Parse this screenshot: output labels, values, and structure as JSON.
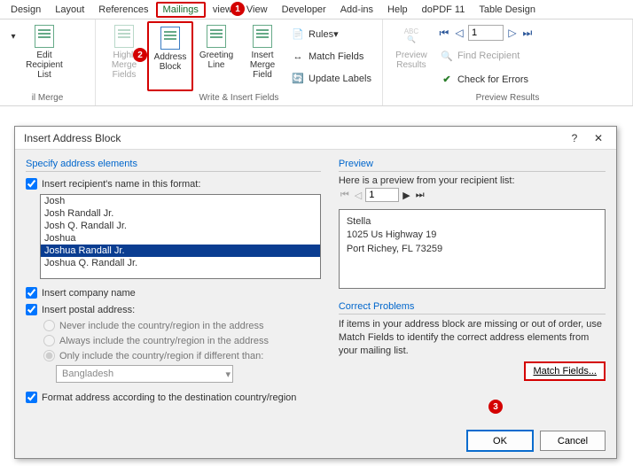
{
  "tabs": {
    "design": "Design",
    "layout": "Layout",
    "references": "References",
    "mailings": "Mailings",
    "review": "view",
    "view": "View",
    "developer": "Developer",
    "addins": "Add-ins",
    "help": "Help",
    "dopdf": "doPDF 11",
    "tabledesign": "Table Design"
  },
  "ribbon": {
    "start": {
      "edit": "Edit\nRecipient List",
      "group": "il Merge"
    },
    "write": {
      "highlight": "Highli\nMerge Fields",
      "address": "Address\nBlock",
      "greeting": "Greeting\nLine",
      "insertmerge": "Insert Merge\nField",
      "rules": "Rules",
      "match": "Match Fields",
      "update": "Update Labels",
      "group": "Write & Insert Fields"
    },
    "preview": {
      "abc": "ABC",
      "preview": "Preview\nResults",
      "find": "Find Recipient",
      "check": "Check for Errors",
      "group": "Preview Results",
      "navval": "1"
    }
  },
  "dialog": {
    "title": "Insert Address Block",
    "specify": "Specify address elements",
    "ck_name": "Insert recipient's name in this format:",
    "names": [
      "Josh",
      "Josh Randall Jr.",
      "Josh Q. Randall Jr.",
      "Joshua",
      "Joshua Randall Jr.",
      "Joshua Q. Randall Jr."
    ],
    "ck_company": "Insert company name",
    "ck_postal": "Insert postal address:",
    "r_never": "Never include the country/region in the address",
    "r_always": "Always include the country/region in the address",
    "r_only": "Only include the country/region if different than:",
    "combo": "Bangladesh",
    "ck_format": "Format address according to the destination country/region",
    "preview": "Preview",
    "preview_sub": "Here is a preview from your recipient list:",
    "preview_nav": "1",
    "p1": "Stella",
    "p2": "1025 Us Highway 19",
    "p3": "Port Richey, FL 73259",
    "correct": "Correct Problems",
    "correct_txt": "If items in your address block are missing or out of order, use Match Fields to identify the correct address elements from your mailing list.",
    "match": "Match Fields...",
    "ok": "OK",
    "cancel": "Cancel",
    "help": "?",
    "close": "✕"
  }
}
